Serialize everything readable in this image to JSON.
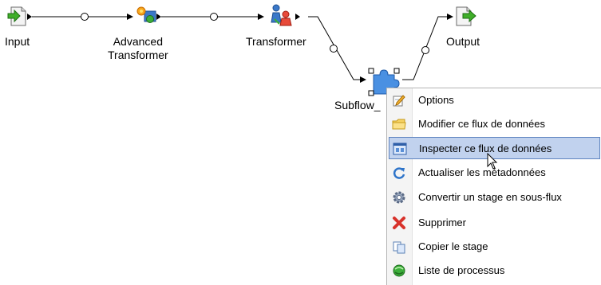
{
  "flow": {
    "nodes": [
      {
        "label": "Input"
      },
      {
        "label": "Advanced\nTransformer"
      },
      {
        "label": "Transformer"
      },
      {
        "label": "Subflow_"
      },
      {
        "label": "Output"
      }
    ]
  },
  "context_menu": {
    "items": [
      {
        "label": "Options",
        "icon": "edit-options-icon"
      },
      {
        "label": "Modifier ce flux de données",
        "icon": "folder-icon"
      },
      {
        "label": "Inspecter ce flux de données",
        "icon": "inspect-window-icon",
        "highlighted": true
      },
      {
        "label": "Actualiser les métadonnées",
        "icon": "refresh-icon"
      },
      {
        "label": "Convertir un stage en sous-flux",
        "icon": "gear-icon"
      },
      {
        "label": "Supprimer",
        "icon": "delete-x-icon"
      },
      {
        "label": "Copier le stage",
        "icon": "copy-icon"
      },
      {
        "label": "Liste de processus",
        "icon": "process-list-icon"
      }
    ]
  },
  "colors": {
    "highlight_bg": "#c1d2ee",
    "highlight_border": "#5f84c0"
  }
}
